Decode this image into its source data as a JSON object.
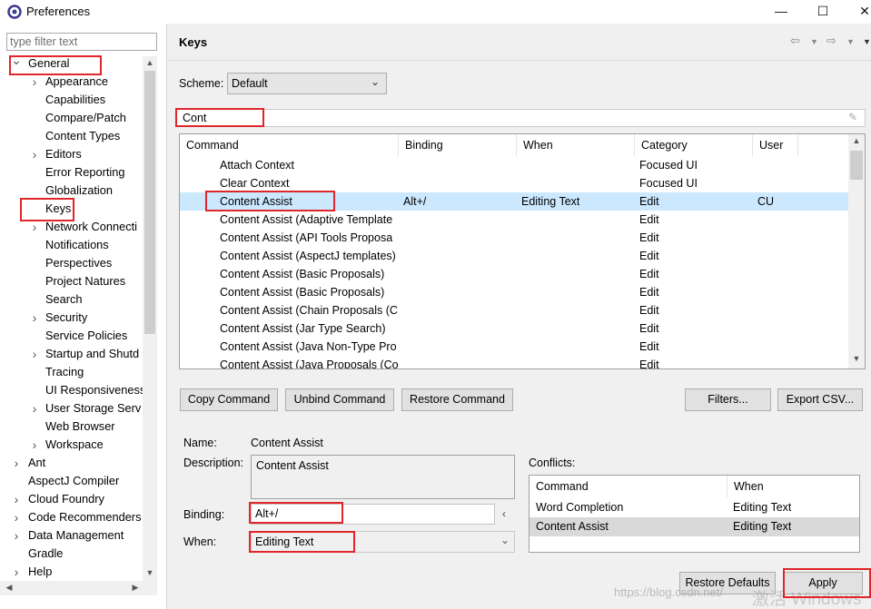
{
  "window": {
    "title": "Preferences",
    "minimize": "—",
    "maximize": "☐",
    "close": "✕"
  },
  "left": {
    "filter_placeholder": "type filter text",
    "tree": [
      {
        "label": "General",
        "indent": 0,
        "twisty": "open",
        "name": "tree-item-general"
      },
      {
        "label": "Appearance",
        "indent": 1,
        "twisty": "closed",
        "name": "tree-item-appearance"
      },
      {
        "label": "Capabilities",
        "indent": 1,
        "twisty": "none",
        "name": "tree-item-capabilities"
      },
      {
        "label": "Compare/Patch",
        "indent": 1,
        "twisty": "none",
        "name": "tree-item-compare-patch"
      },
      {
        "label": "Content Types",
        "indent": 1,
        "twisty": "none",
        "name": "tree-item-content-types"
      },
      {
        "label": "Editors",
        "indent": 1,
        "twisty": "closed",
        "name": "tree-item-editors"
      },
      {
        "label": "Error Reporting",
        "indent": 1,
        "twisty": "none",
        "name": "tree-item-error-reporting"
      },
      {
        "label": "Globalization",
        "indent": 1,
        "twisty": "none",
        "name": "tree-item-globalization"
      },
      {
        "label": "Keys",
        "indent": 1,
        "twisty": "none",
        "name": "tree-item-keys"
      },
      {
        "label": "Network Connecti",
        "indent": 1,
        "twisty": "closed",
        "name": "tree-item-network-connections"
      },
      {
        "label": "Notifications",
        "indent": 1,
        "twisty": "none",
        "name": "tree-item-notifications"
      },
      {
        "label": "Perspectives",
        "indent": 1,
        "twisty": "none",
        "name": "tree-item-perspectives"
      },
      {
        "label": "Project Natures",
        "indent": 1,
        "twisty": "none",
        "name": "tree-item-project-natures"
      },
      {
        "label": "Search",
        "indent": 1,
        "twisty": "none",
        "name": "tree-item-search"
      },
      {
        "label": "Security",
        "indent": 1,
        "twisty": "closed",
        "name": "tree-item-security"
      },
      {
        "label": "Service Policies",
        "indent": 1,
        "twisty": "none",
        "name": "tree-item-service-policies"
      },
      {
        "label": "Startup and Shutd",
        "indent": 1,
        "twisty": "closed",
        "name": "tree-item-startup-shutdown"
      },
      {
        "label": "Tracing",
        "indent": 1,
        "twisty": "none",
        "name": "tree-item-tracing"
      },
      {
        "label": "UI Responsiveness",
        "indent": 1,
        "twisty": "none",
        "name": "tree-item-ui-responsiveness"
      },
      {
        "label": "User Storage Serv",
        "indent": 1,
        "twisty": "closed",
        "name": "tree-item-user-storage"
      },
      {
        "label": "Web Browser",
        "indent": 1,
        "twisty": "none",
        "name": "tree-item-web-browser"
      },
      {
        "label": "Workspace",
        "indent": 1,
        "twisty": "closed",
        "name": "tree-item-workspace"
      },
      {
        "label": "Ant",
        "indent": 0,
        "twisty": "closed",
        "name": "tree-item-ant"
      },
      {
        "label": "AspectJ Compiler",
        "indent": 0,
        "twisty": "none",
        "name": "tree-item-aspectj-compiler"
      },
      {
        "label": "Cloud Foundry",
        "indent": 0,
        "twisty": "closed",
        "name": "tree-item-cloud-foundry"
      },
      {
        "label": "Code Recommenders",
        "indent": 0,
        "twisty": "closed",
        "name": "tree-item-code-recommenders"
      },
      {
        "label": "Data Management",
        "indent": 0,
        "twisty": "closed",
        "name": "tree-item-data-management"
      },
      {
        "label": "Gradle",
        "indent": 0,
        "twisty": "none",
        "name": "tree-item-gradle"
      },
      {
        "label": "Help",
        "indent": 0,
        "twisty": "closed",
        "name": "tree-item-help"
      }
    ]
  },
  "page": {
    "title": "Keys",
    "scheme_label": "Scheme:",
    "scheme_value": "Default",
    "filter_value": "Cont",
    "columns": [
      "Command",
      "Binding",
      "When",
      "Category",
      "User"
    ],
    "rows": [
      {
        "command": "Attach Context",
        "binding": "",
        "when": "",
        "category": "Focused UI",
        "user": ""
      },
      {
        "command": "Clear Context",
        "binding": "",
        "when": "",
        "category": "Focused UI",
        "user": ""
      },
      {
        "command": "Content Assist",
        "binding": "Alt+/",
        "when": "Editing Text",
        "category": "Edit",
        "user": "CU"
      },
      {
        "command": "Content Assist (Adaptive Template",
        "binding": "",
        "when": "",
        "category": "Edit",
        "user": ""
      },
      {
        "command": "Content Assist (API Tools Proposa",
        "binding": "",
        "when": "",
        "category": "Edit",
        "user": ""
      },
      {
        "command": "Content Assist (AspectJ templates)",
        "binding": "",
        "when": "",
        "category": "Edit",
        "user": ""
      },
      {
        "command": "Content Assist (Basic Proposals)",
        "binding": "",
        "when": "",
        "category": "Edit",
        "user": ""
      },
      {
        "command": "Content Assist (Basic Proposals)",
        "binding": "",
        "when": "",
        "category": "Edit",
        "user": ""
      },
      {
        "command": "Content Assist (Chain Proposals (C",
        "binding": "",
        "when": "",
        "category": "Edit",
        "user": ""
      },
      {
        "command": "Content Assist (Jar Type Search)",
        "binding": "",
        "when": "",
        "category": "Edit",
        "user": ""
      },
      {
        "command": "Content Assist (Java Non-Type Pro",
        "binding": "",
        "when": "",
        "category": "Edit",
        "user": ""
      },
      {
        "command": "Content Assist (Java Proposals (Co",
        "binding": "",
        "when": "",
        "category": "Edit",
        "user": ""
      }
    ],
    "buttons": {
      "copy": "Copy Command",
      "unbind": "Unbind Command",
      "restore": "Restore Command",
      "filters": "Filters...",
      "export": "Export CSV..."
    },
    "details": {
      "name_label": "Name:",
      "name_value": "Content Assist",
      "description_label": "Description:",
      "description_value": "Content Assist",
      "binding_label": "Binding:",
      "binding_value": "Alt+/",
      "when_label": "When:",
      "when_value": "Editing Text"
    },
    "conflicts": {
      "label": "Conflicts:",
      "columns": [
        "Command",
        "When"
      ],
      "rows": [
        {
          "command": "Word Completion",
          "when": "Editing Text"
        },
        {
          "command": "Content Assist",
          "when": "Editing Text"
        }
      ]
    },
    "restore_defaults": "Restore Defaults",
    "apply": "Apply"
  },
  "watermark": "https://blog.csdn.net/",
  "watermark2": "激活 Windows",
  "colors": {
    "highlight": "#e0262a",
    "selection": "#cce8ff"
  }
}
